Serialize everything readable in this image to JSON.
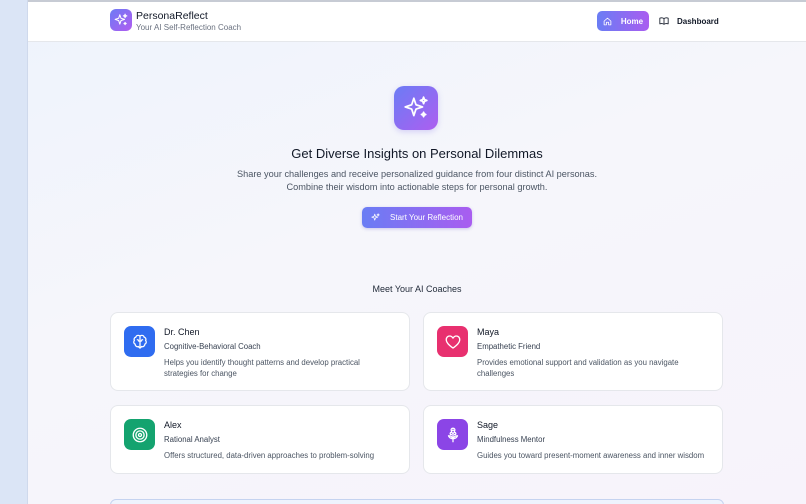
{
  "brand": {
    "name": "PersonaReflect",
    "tagline": "Your AI Self-Reflection Coach",
    "logo_icon": "sparkles-icon"
  },
  "nav": {
    "home_label": "Home",
    "home_icon": "home-icon",
    "dashboard_label": "Dashboard",
    "dashboard_icon": "book-open-icon"
  },
  "hero": {
    "icon": "sparkles-icon",
    "title": "Get Diverse Insights on Personal Dilemmas",
    "subtitle_line1": "Share your challenges and receive personalized guidance from four distinct AI personas.",
    "subtitle_line2": "Combine their wisdom into actionable steps for personal growth.",
    "cta_label": "Start Your Reflection"
  },
  "coaches_section": {
    "title": "Meet Your AI Coaches",
    "coaches": [
      {
        "name": "Dr. Chen",
        "role": "Cognitive-Behavioral Coach",
        "description": "Helps you identify thought patterns and develop practical strategies for change",
        "icon": "brain-icon",
        "color": "#2f6cf0"
      },
      {
        "name": "Maya",
        "role": "Empathetic Friend",
        "description": "Provides emotional support and validation as you navigate challenges",
        "icon": "heart-icon",
        "color": "#e8306f"
      },
      {
        "name": "Alex",
        "role": "Rational Analyst",
        "description": "Offers structured, data-driven approaches to problem-solving",
        "icon": "target-icon",
        "color": "#14a36f"
      },
      {
        "name": "Sage",
        "role": "Mindfulness Mentor",
        "description": "Guides you toward present-moment awareness and inner wisdom",
        "icon": "flower-icon",
        "color": "#8b45e6"
      }
    ]
  },
  "colors": {
    "accent_start": "#6a7df4",
    "accent_end": "#a95df0"
  }
}
